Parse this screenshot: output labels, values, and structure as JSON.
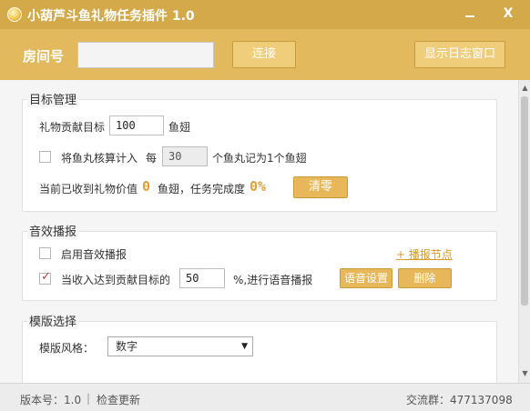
{
  "window": {
    "title": "小葫芦斗鱼礼物任务插件 1.0",
    "minimize_symbol": "—",
    "close_symbol": "X"
  },
  "topbar": {
    "room_label": "房间号",
    "room_value": "",
    "connect_label": "连接",
    "show_log_label": "显示日志窗口"
  },
  "target": {
    "legend": "目标管理",
    "goal_label": "礼物贡献目标",
    "goal_value": "100",
    "goal_unit": "鱼翅",
    "fishball_checked": false,
    "fishball_label": "将鱼丸核算计入",
    "every_label": "每",
    "fishball_value": "30",
    "fishball_suffix": "个鱼丸记为1个鱼翅",
    "received_label": "当前已收到礼物价值",
    "received_value": "0",
    "received_unit": "鱼翅，任务完成度",
    "completion_value": "0%",
    "reset_label": "清零"
  },
  "sound": {
    "legend": "音效播报",
    "enable_checked": false,
    "enable_label": "启用音效播报",
    "node_link": "+ 播报节点",
    "voice_checked": true,
    "voice_label": "当收入达到贡献目标的",
    "voice_value": "50",
    "voice_suffix": "%,进行语音播报",
    "voice_settings_label": "语音设置",
    "delete_label": "删除"
  },
  "template": {
    "legend": "模版选择",
    "style_label": "模版风格：",
    "style_value": "数字"
  },
  "status": {
    "version": "版本号：1.0",
    "divider": "|",
    "check_update": "检查更新",
    "group": "交流群：477137098"
  },
  "colors": {
    "titlebar": "#d4a94a",
    "topbar": "#e2b95c",
    "accent": "#e0a03a"
  }
}
